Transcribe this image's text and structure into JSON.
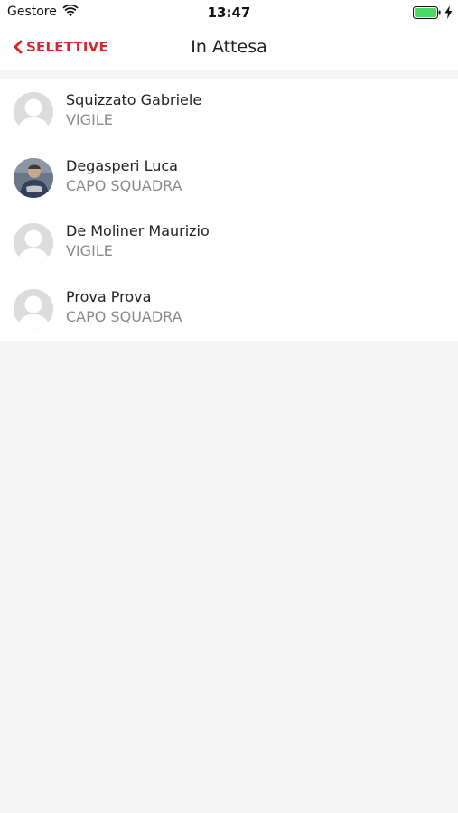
{
  "status_bar": {
    "carrier": "Gestore",
    "time": "13:47",
    "icons": [
      "wifi-icon",
      "battery-icon",
      "charging-bolt-icon"
    ],
    "battery_color": "#4cd964"
  },
  "nav": {
    "back_label": "SELETTIVE",
    "title": "In Attesa",
    "accent_color": "#d7262e"
  },
  "people": [
    {
      "name": "Squizzato Gabriele",
      "role": "VIGILE",
      "avatar": "placeholder"
    },
    {
      "name": "Degasperi Luca",
      "role": "CAPO SQUADRA",
      "avatar": "photo"
    },
    {
      "name": "De Moliner Maurizio",
      "role": "VIGILE",
      "avatar": "placeholder"
    },
    {
      "name": "Prova Prova",
      "role": "CAPO SQUADRA",
      "avatar": "placeholder"
    }
  ]
}
